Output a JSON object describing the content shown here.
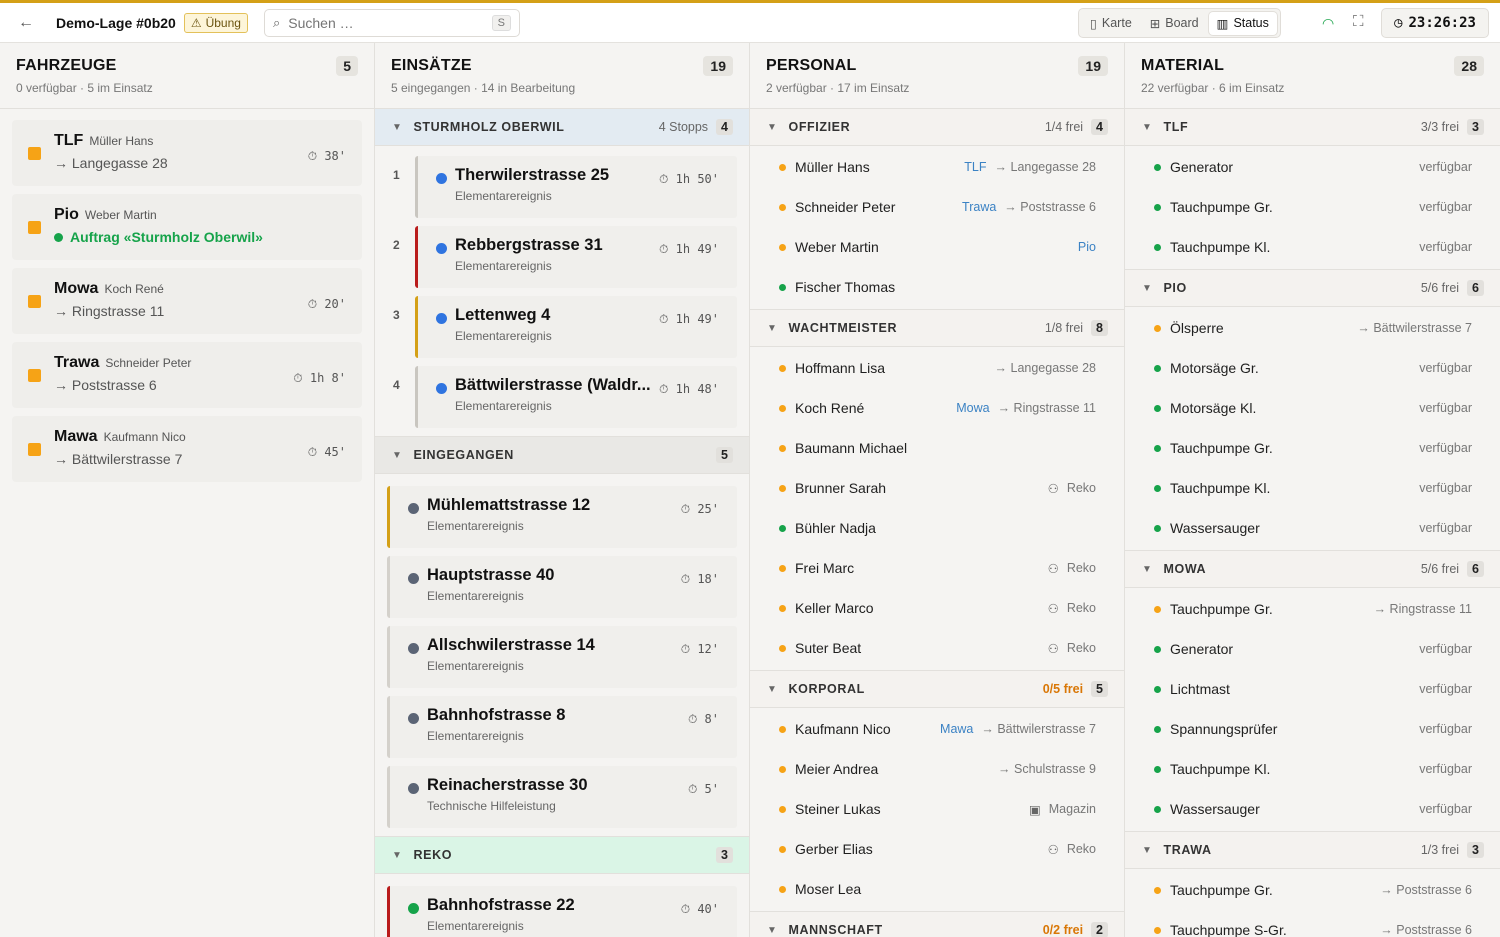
{
  "header": {
    "title": "Demo-Lage #0b20",
    "badge": "Übung",
    "search_placeholder": "Suchen …",
    "search_key": "S",
    "views": [
      {
        "label": "Karte",
        "icon": "map-icon"
      },
      {
        "label": "Board",
        "icon": "board-icon"
      },
      {
        "label": "Status",
        "icon": "chart-icon"
      }
    ],
    "clock": "23:26:23"
  },
  "fahrzeuge": {
    "title": "FAHRZEUGE",
    "sub": "0 verfügbar · 5 im Einsatz",
    "count": "5",
    "items": [
      {
        "name": "TLF",
        "person": "Müller Hans",
        "dest": "→ Langegasse 28",
        "time": "38'"
      },
      {
        "name": "Pio",
        "person": "Weber Martin",
        "dest": "Auftrag «Sturmholz Oberwil»",
        "time": ""
      },
      {
        "name": "Mowa",
        "person": "Koch René",
        "dest": "→ Ringstrasse 11",
        "time": "20'"
      },
      {
        "name": "Trawa",
        "person": "Schneider Peter",
        "dest": "→ Poststrasse 6",
        "time": "1h 8'"
      },
      {
        "name": "Mawa",
        "person": "Kaufmann Nico",
        "dest": "→ Bättwilerstrasse 7",
        "time": "45'"
      }
    ]
  },
  "einsaetze": {
    "title": "EINSÄTZE",
    "sub": "5 eingegangen · 14 in Bearbeitung",
    "count": "19",
    "sections": [
      {
        "label": "STURMHOLZ OBERWIL",
        "extra": "4 Stopps",
        "count": "4"
      },
      {
        "label": "EINGEGANGEN",
        "count": "5"
      },
      {
        "label": "REKO",
        "count": "3"
      }
    ],
    "stops": [
      {
        "num": "1",
        "name": "Therwilerstrasse 25",
        "type": "Elementarereignis",
        "time": "1h 50'",
        "bar": "#c9c6c0"
      },
      {
        "num": "2",
        "name": "Rebbergstrasse 31",
        "type": "Elementarereignis",
        "time": "1h 49'",
        "bar": "#b91c1c"
      },
      {
        "num": "3",
        "name": "Lettenweg 4",
        "type": "Elementarereignis",
        "time": "1h 49'",
        "bar": "#d4a017"
      },
      {
        "num": "4",
        "name": "Bättwilerstrasse (Waldr...",
        "type": "Elementarereignis",
        "time": "1h 48'",
        "bar": "#c9c6c0"
      }
    ],
    "eingegangen": [
      {
        "name": "Mühlemattstrasse 12",
        "type": "Elementarereignis",
        "time": "25'",
        "bar": "#d4a017"
      },
      {
        "name": "Hauptstrasse 40",
        "type": "Elementarereignis",
        "time": "18'",
        "bar": "#d4d1cb"
      },
      {
        "name": "Allschwilerstrasse 14",
        "type": "Elementarereignis",
        "time": "12'",
        "bar": "#d4d1cb"
      },
      {
        "name": "Bahnhofstrasse 8",
        "type": "Elementarereignis",
        "time": "8'",
        "bar": "#d4d1cb"
      },
      {
        "name": "Reinacherstrasse 30",
        "type": "Technische Hilfeleistung",
        "time": "5'",
        "bar": "#d4d1cb"
      }
    ],
    "reko": [
      {
        "name": "Bahnhofstrasse 22",
        "type": "Elementarereignis",
        "time": "40'",
        "bar": "#b91c1c"
      }
    ]
  },
  "personal": {
    "title": "PERSONAL",
    "sub": "2 verfügbar · 17 im Einsatz",
    "count": "19",
    "groups": [
      {
        "label": "OFFIZIER",
        "free": "1/4 frei",
        "count": "4",
        "warn": false,
        "people": [
          {
            "name": "Müller Hans",
            "veh": "TLF",
            "status": "→ Langegasse 28",
            "color": "or"
          },
          {
            "name": "Schneider Peter",
            "veh": "Trawa",
            "status": "→ Poststrasse 6",
            "color": "or"
          },
          {
            "name": "Weber Martin",
            "veh": "Pio",
            "status": "",
            "color": "or"
          },
          {
            "name": "Fischer Thomas",
            "veh": "",
            "status": "",
            "color": "gr"
          }
        ]
      },
      {
        "label": "WACHTMEISTER",
        "free": "1/8 frei",
        "count": "8",
        "warn": false,
        "people": [
          {
            "name": "Hoffmann Lisa",
            "veh": "",
            "status": "→ Langegasse 28",
            "color": "or"
          },
          {
            "name": "Koch René",
            "veh": "Mowa",
            "status": "→ Ringstrasse 11",
            "color": "or"
          },
          {
            "name": "Baumann Michael",
            "veh": "",
            "status": "",
            "color": "or"
          },
          {
            "name": "Brunner Sarah",
            "veh": "",
            "status": "Reko",
            "color": "or"
          },
          {
            "name": "Bühler Nadja",
            "veh": "",
            "status": "",
            "color": "gr"
          },
          {
            "name": "Frei Marc",
            "veh": "",
            "status": "Reko",
            "color": "or"
          },
          {
            "name": "Keller Marco",
            "veh": "",
            "status": "Reko",
            "color": "or"
          },
          {
            "name": "Suter Beat",
            "veh": "",
            "status": "Reko",
            "color": "or"
          }
        ]
      },
      {
        "label": "KORPORAL",
        "free": "0/5 frei",
        "count": "5",
        "warn": true,
        "people": [
          {
            "name": "Kaufmann Nico",
            "veh": "Mawa",
            "status": "→ Bättwilerstrasse 7",
            "color": "or"
          },
          {
            "name": "Meier Andrea",
            "veh": "",
            "status": "→ Schulstrasse 9",
            "color": "or"
          },
          {
            "name": "Steiner Lukas",
            "veh": "",
            "status": "Magazin",
            "color": "or"
          },
          {
            "name": "Gerber Elias",
            "veh": "",
            "status": "Reko",
            "color": "or"
          },
          {
            "name": "Moser Lea",
            "veh": "",
            "status": "",
            "color": "or"
          }
        ]
      },
      {
        "label": "MANNSCHAFT",
        "free": "0/2 frei",
        "count": "2",
        "warn": true,
        "people": []
      }
    ]
  },
  "material": {
    "title": "MATERIAL",
    "sub": "22 verfügbar · 6 im Einsatz",
    "count": "28",
    "groups": [
      {
        "label": "TLF",
        "free": "3/3 frei",
        "count": "3",
        "items": [
          {
            "name": "Generator",
            "status": "verfügbar",
            "color": "gr"
          },
          {
            "name": "Tauchpumpe Gr.",
            "status": "verfügbar",
            "color": "gr"
          },
          {
            "name": "Tauchpumpe Kl.",
            "status": "verfügbar",
            "color": "gr"
          }
        ]
      },
      {
        "label": "PIO",
        "free": "5/6 frei",
        "count": "6",
        "items": [
          {
            "name": "Ölsperre",
            "status": "→ Bättwilerstrasse 7",
            "color": "or"
          },
          {
            "name": "Motorsäge Gr.",
            "status": "verfügbar",
            "color": "gr"
          },
          {
            "name": "Motorsäge Kl.",
            "status": "verfügbar",
            "color": "gr"
          },
          {
            "name": "Tauchpumpe Gr.",
            "status": "verfügbar",
            "color": "gr"
          },
          {
            "name": "Tauchpumpe Kl.",
            "status": "verfügbar",
            "color": "gr"
          },
          {
            "name": "Wassersauger",
            "status": "verfügbar",
            "color": "gr"
          }
        ]
      },
      {
        "label": "MOWA",
        "free": "5/6 frei",
        "count": "6",
        "items": [
          {
            "name": "Tauchpumpe Gr.",
            "status": "→ Ringstrasse 11",
            "color": "or"
          },
          {
            "name": "Generator",
            "status": "verfügbar",
            "color": "gr"
          },
          {
            "name": "Lichtmast",
            "status": "verfügbar",
            "color": "gr"
          },
          {
            "name": "Spannungsprüfer",
            "status": "verfügbar",
            "color": "gr"
          },
          {
            "name": "Tauchpumpe Kl.",
            "status": "verfügbar",
            "color": "gr"
          },
          {
            "name": "Wassersauger",
            "status": "verfügbar",
            "color": "gr"
          }
        ]
      },
      {
        "label": "TRAWA",
        "free": "1/3 frei",
        "count": "3",
        "items": [
          {
            "name": "Tauchpumpe Gr.",
            "status": "→ Poststrasse 6",
            "color": "or"
          },
          {
            "name": "Tauchpumpe S-Gr.",
            "status": "→ Poststrasse 6",
            "color": "or"
          }
        ]
      }
    ]
  }
}
